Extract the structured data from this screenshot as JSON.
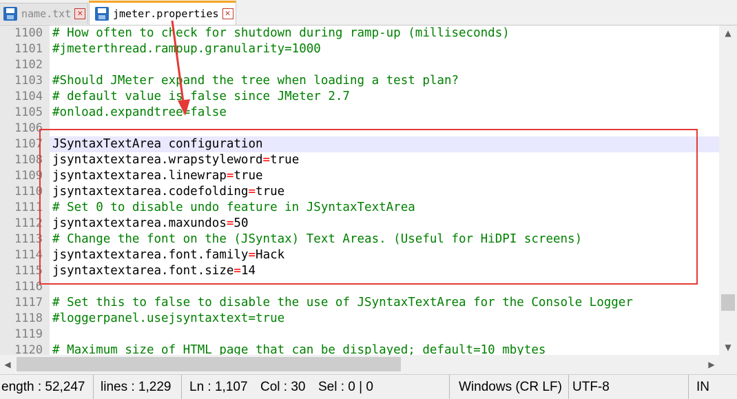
{
  "tabs": [
    {
      "label": "name.txt",
      "active": false,
      "icon": "save-icon"
    },
    {
      "label": "jmeter.properties",
      "active": true,
      "icon": "save-icon"
    }
  ],
  "editor": {
    "current_line": "1107",
    "lines": [
      {
        "num": "1100",
        "type": "comment",
        "text": "# How often to check for shutdown during ramp-up (milliseconds)"
      },
      {
        "num": "1101",
        "type": "comment",
        "text": "#jmeterthread.rampup.granularity=1000"
      },
      {
        "num": "1102",
        "type": "blank",
        "text": ""
      },
      {
        "num": "1103",
        "type": "comment",
        "text": "#Should JMeter expand the tree when loading a test plan?"
      },
      {
        "num": "1104",
        "type": "comment",
        "text": "# default value is false since JMeter 2.7"
      },
      {
        "num": "1105",
        "type": "comment",
        "text": "#onload.expandtree=false"
      },
      {
        "num": "1106",
        "type": "blank",
        "text": ""
      },
      {
        "num": "1107",
        "type": "plain",
        "text": "JSyntaxTextArea configuration"
      },
      {
        "num": "1108",
        "type": "property",
        "key": "jsyntaxtextarea.wrapstyleword",
        "value": "true"
      },
      {
        "num": "1109",
        "type": "property",
        "key": "jsyntaxtextarea.linewrap",
        "value": "true"
      },
      {
        "num": "1110",
        "type": "property",
        "key": "jsyntaxtextarea.codefolding",
        "value": "true"
      },
      {
        "num": "1111",
        "type": "comment",
        "text": "# Set 0 to disable undo feature in JSyntaxTextArea"
      },
      {
        "num": "1112",
        "type": "property",
        "key": "jsyntaxtextarea.maxundos",
        "value": "50"
      },
      {
        "num": "1113",
        "type": "comment",
        "text": "# Change the font on the (JSyntax) Text Areas. (Useful for HiDPI screens)"
      },
      {
        "num": "1114",
        "type": "property",
        "key": "jsyntaxtextarea.font.family",
        "value": "Hack"
      },
      {
        "num": "1115",
        "type": "property",
        "key": "jsyntaxtextarea.font.size",
        "value": "14"
      },
      {
        "num": "1116",
        "type": "blank",
        "text": ""
      },
      {
        "num": "1117",
        "type": "comment",
        "text": "# Set this to false to disable the use of JSyntaxTextArea for the Console Logger"
      },
      {
        "num": "1118",
        "type": "comment",
        "text": "#loggerpanel.usejsyntaxtext=true"
      },
      {
        "num": "1119",
        "type": "blank",
        "text": ""
      },
      {
        "num": "1120",
        "type": "comment",
        "text": "# Maximum size of HTML page that can be displayed; default=10 mbytes"
      }
    ]
  },
  "statusbar": {
    "length": "ength : 52,247",
    "lines": "lines : 1,229",
    "ln": "Ln : 1,107",
    "col": "Col : 30",
    "sel": "Sel : 0 | 0",
    "eol": "Windows (CR LF)",
    "encoding": "UTF-8",
    "mode": "IN"
  },
  "colors": {
    "comment": "#008000",
    "operator": "#ff0000",
    "current_line": "#e8e8ff",
    "annotation": "#e53935",
    "active_tab_accent": "#f5a623"
  }
}
